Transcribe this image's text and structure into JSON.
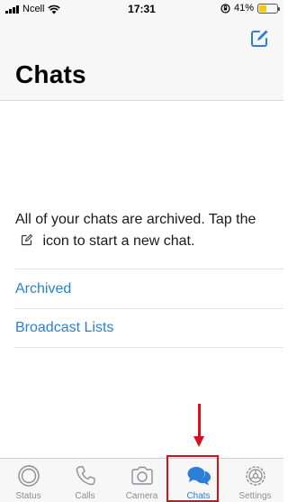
{
  "status_bar": {
    "carrier": "Ncell",
    "time": "17:31",
    "battery_text": "41%",
    "battery_level": 0.41,
    "battery_color": "#f5c518"
  },
  "header": {
    "title": "Chats",
    "compose_icon": "compose-icon"
  },
  "main": {
    "message_part1": "All of your chats are archived. Tap the",
    "message_part2": "icon to start a new chat.",
    "list_items": [
      {
        "label": "Archived"
      },
      {
        "label": "Broadcast Lists"
      }
    ]
  },
  "tabs": [
    {
      "label": "Status",
      "icon": "status-icon",
      "active": false
    },
    {
      "label": "Calls",
      "icon": "phone-icon",
      "active": false
    },
    {
      "label": "Camera",
      "icon": "camera-icon",
      "active": false
    },
    {
      "label": "Chats",
      "icon": "chat-bubbles-icon",
      "active": true
    },
    {
      "label": "Settings",
      "icon": "gear-icon",
      "active": false
    }
  ],
  "colors": {
    "accent": "#2b7fd6",
    "inactive": "#8e8e93",
    "annotation": "#d8101a"
  }
}
